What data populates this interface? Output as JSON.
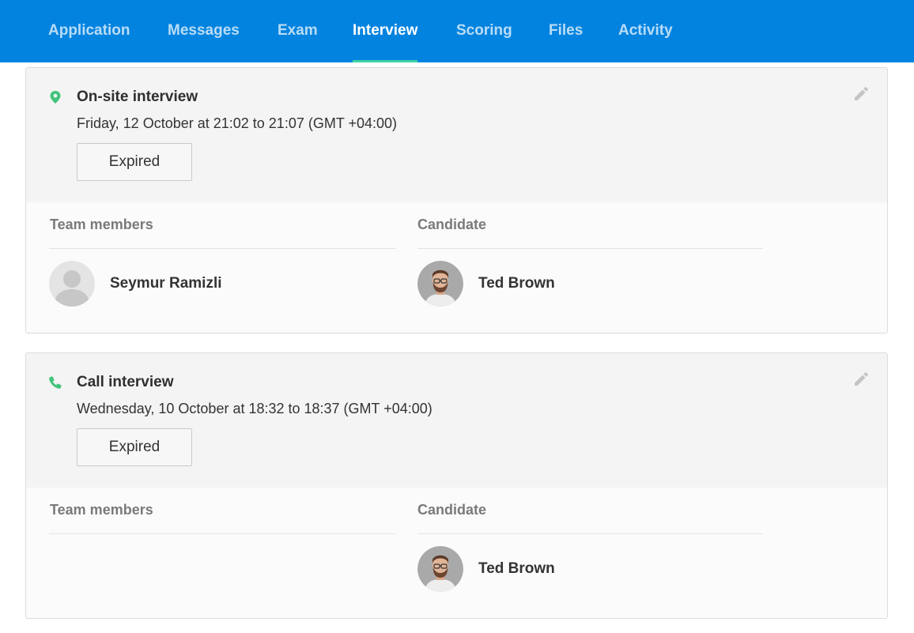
{
  "nav": {
    "tabs": [
      {
        "label": "Application",
        "active": false
      },
      {
        "label": "Messages",
        "active": false
      },
      {
        "label": "Exam",
        "active": false
      },
      {
        "label": "Interview",
        "active": true
      },
      {
        "label": "Scoring",
        "active": false
      },
      {
        "label": "Files",
        "active": false
      },
      {
        "label": "Activity",
        "active": false
      }
    ]
  },
  "interviews": [
    {
      "type_icon": "location-pin-icon",
      "type": "On-site interview",
      "when": "Friday, 12 October at 21:02 to 21:07 (GMT +04:00)",
      "status": "Expired",
      "team_label": "Team members",
      "candidate_label": "Candidate",
      "team_members": [
        {
          "name": "Seymur Ramizli",
          "avatar": "default-avatar-icon"
        }
      ],
      "candidate": {
        "name": "Ted Brown",
        "avatar": "photo"
      }
    },
    {
      "type_icon": "phone-icon",
      "type": "Call interview",
      "when": "Wednesday, 10 October at 18:32 to 18:37 (GMT +04:00)",
      "status": "Expired",
      "team_label": "Team members",
      "candidate_label": "Candidate",
      "team_members": [],
      "candidate": {
        "name": "Ted Brown",
        "avatar": "photo"
      }
    }
  ],
  "colors": {
    "nav": "#0283df",
    "accent": "#3fd3a6",
    "icon_green": "#41c47b"
  }
}
